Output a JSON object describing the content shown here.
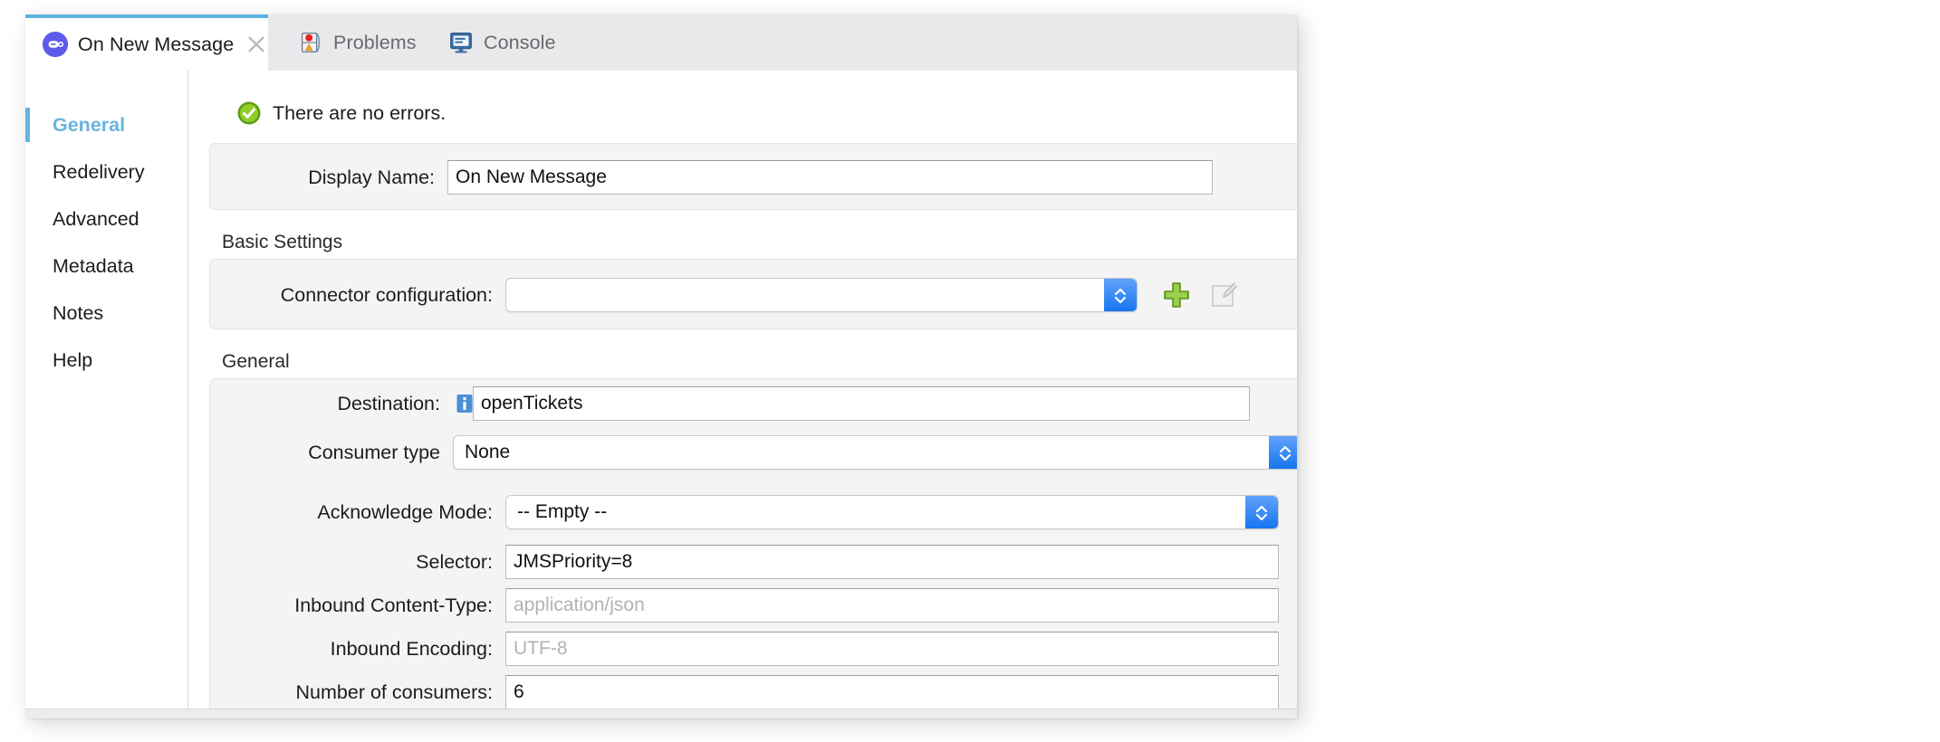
{
  "window": {
    "title": "On New Message"
  },
  "tabs": [
    {
      "label": "On New Message",
      "icon": "message-bubble-icon",
      "active": true,
      "closable": true
    },
    {
      "label": "Problems",
      "icon": "traffic-light-icon",
      "active": false,
      "closable": false
    },
    {
      "label": "Console",
      "icon": "console-monitor-icon",
      "active": false,
      "closable": false
    }
  ],
  "sidebar": {
    "items": [
      {
        "label": "General",
        "selected": true
      },
      {
        "label": "Redelivery",
        "selected": false
      },
      {
        "label": "Advanced",
        "selected": false
      },
      {
        "label": "Metadata",
        "selected": false
      },
      {
        "label": "Notes",
        "selected": false
      },
      {
        "label": "Help",
        "selected": false
      }
    ]
  },
  "status": {
    "icon": "success-check-icon",
    "text": "There are no errors."
  },
  "form": {
    "display_name": {
      "label": "Display Name:",
      "value": "On New Message",
      "placeholder": ""
    },
    "basic_settings": {
      "title": "Basic Settings",
      "connector_configuration": {
        "label": "Connector configuration:",
        "value": "",
        "add_button_icon": "green-plus-icon",
        "edit_button_icon": "edit-pencil-icon"
      }
    },
    "general": {
      "title": "General",
      "destination": {
        "label": "Destination:",
        "value": "openTickets",
        "info_icon": "info-icon"
      },
      "consumer_type": {
        "label": "Consumer type",
        "value": "None"
      },
      "acknowledge_mode": {
        "label": "Acknowledge Mode:",
        "value": "-- Empty --"
      },
      "selector": {
        "label": "Selector:",
        "value": "JMSPriority=8"
      },
      "inbound_content_type": {
        "label": "Inbound Content-Type:",
        "value": "",
        "placeholder": "application/json"
      },
      "inbound_encoding": {
        "label": "Inbound Encoding:",
        "value": "",
        "placeholder": "UTF-8"
      },
      "number_of_consumers": {
        "label": "Number of consumers:",
        "value": "6"
      }
    }
  },
  "colors": {
    "accent": "#69b4e0",
    "tab_top_bar": "#5bb3e0",
    "combo_blue": "#1273f0",
    "success_green": "#76b62a",
    "plus_green": "#8cc63f",
    "info_blue": "#4a8fd4"
  }
}
